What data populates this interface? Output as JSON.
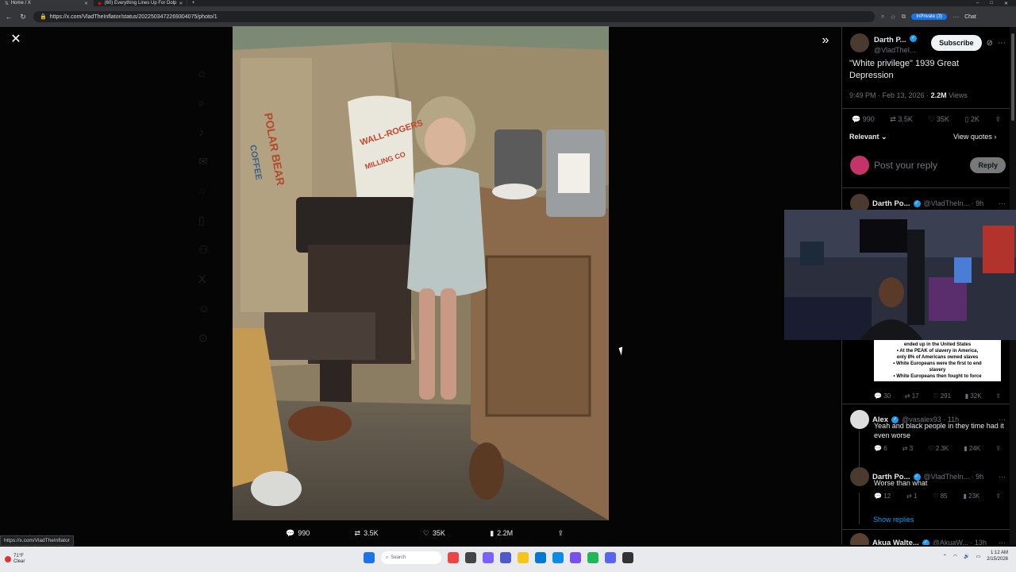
{
  "browser": {
    "tabs": [
      {
        "label": "Home / X",
        "active": true
      },
      {
        "label": "(60) Everything Lines Up For Dolp",
        "active": false
      }
    ],
    "url": "https://x.com/VladTheInflator/status/2022503472269304075/photo/1",
    "inprivate_label": "InPrivate (3)",
    "chat_label": "Chat",
    "status_url": "https://x.com/VladTheInflator"
  },
  "media_bar": {
    "replies": "990",
    "reposts": "3.5K",
    "likes": "35K",
    "views": "2.2M"
  },
  "post": {
    "author_name": "Darth P...",
    "author_handle": "@VladTheI...",
    "subscribe_label": "Subscribe",
    "text": "\"White privilege\" 1939 Great Depression",
    "time": "9:49 PM · Feb 13, 2026 · ",
    "views_count": "2.2M",
    "views_label": " Views",
    "stats": {
      "replies": "990",
      "reposts": "3.5K",
      "likes": "35K",
      "bookmarks": "2K"
    },
    "relevant_label": "Relevant",
    "view_quotes_label": "View quotes",
    "reply_placeholder": "Post your reply",
    "reply_button": "Reply"
  },
  "replies": [
    {
      "name": "Darth Po...",
      "handle": "@VladTheIn... · 9h",
      "quote_lines": [
        "ended up in the United States",
        "• At the PEAK of slavery in America,",
        "only 8% of Americans owned slaves",
        "• White Europeans were the first to end",
        "slavery",
        "• White Europeans then fought to force"
      ],
      "actions": {
        "replies": "30",
        "reposts": "17",
        "likes": "291",
        "views": "32K"
      }
    },
    {
      "name": "Alex",
      "handle": "@vasalex93 · 11h",
      "text": "Yeah  and black people in they time had it even worse",
      "actions": {
        "replies": "6",
        "reposts": "3",
        "likes": "2.3K",
        "views": "24K"
      }
    },
    {
      "name": "Darth Po...",
      "handle": "@VladTheIn... · 9h",
      "text": "Worse than what",
      "actions": {
        "replies": "12",
        "reposts": "1",
        "likes": "85",
        "views": "23K"
      }
    },
    {
      "name": "Akua Walte...",
      "handle": "@AkuaW... · 13h"
    }
  ],
  "show_replies_label": "Show replies",
  "photo_text": {
    "sack_left": "POLAR BEAR",
    "sack_left_sub": "COFFEE",
    "sack_right": "WALL-ROGERS",
    "sack_right_sub": "MILLING CO"
  },
  "taskbar": {
    "weather_temp": "71°F",
    "weather_desc": "Clear",
    "search_placeholder": "Search",
    "time": "1:12 AM",
    "date": "2/15/2026"
  },
  "colors": {
    "accent": "#1d9bf0",
    "background": "#000000"
  }
}
